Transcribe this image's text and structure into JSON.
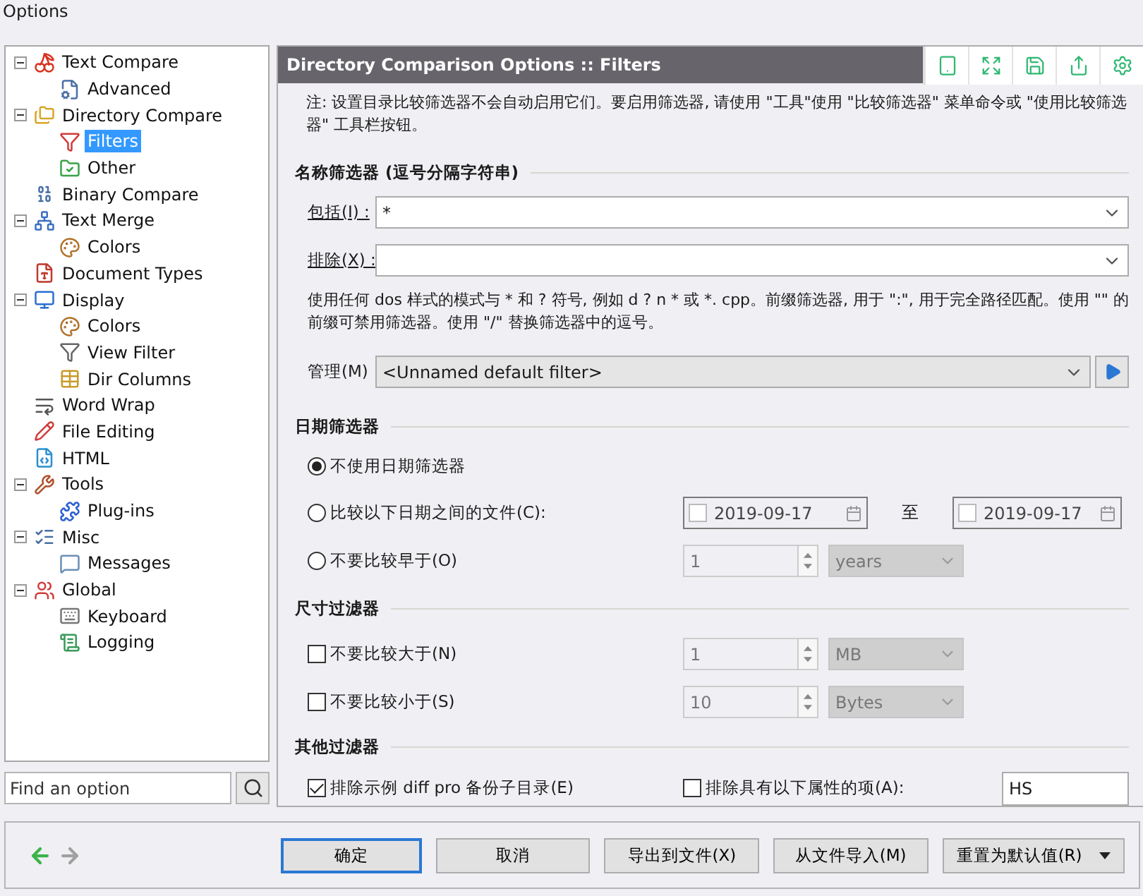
{
  "window": {
    "title": "Options"
  },
  "tree": [
    {
      "label": "Text Compare",
      "expanded": true,
      "selected": false,
      "children": [
        {
          "label": "Advanced",
          "selected": false
        }
      ]
    },
    {
      "label": "Directory Compare",
      "expanded": true,
      "selected": false,
      "children": [
        {
          "label": "Filters",
          "selected": true
        },
        {
          "label": "Other",
          "selected": false
        }
      ]
    },
    {
      "label": "Binary Compare",
      "selected": false
    },
    {
      "label": "Text Merge",
      "expanded": true,
      "selected": false,
      "children": [
        {
          "label": "Colors",
          "selected": false
        }
      ]
    },
    {
      "label": "Document Types",
      "selected": false
    },
    {
      "label": "Display",
      "expanded": true,
      "selected": false,
      "children": [
        {
          "label": "Colors",
          "selected": false
        },
        {
          "label": "View Filter",
          "selected": false
        },
        {
          "label": "Dir Columns",
          "selected": false
        }
      ]
    },
    {
      "label": "Word Wrap",
      "selected": false
    },
    {
      "label": "File Editing",
      "selected": false
    },
    {
      "label": "HTML",
      "selected": false
    },
    {
      "label": "Tools",
      "expanded": true,
      "selected": false,
      "children": [
        {
          "label": "Plug-ins",
          "selected": false
        }
      ]
    },
    {
      "label": "Misc",
      "expanded": true,
      "selected": false,
      "children": [
        {
          "label": "Messages",
          "selected": false
        }
      ]
    },
    {
      "label": "Global",
      "expanded": true,
      "selected": false,
      "children": [
        {
          "label": "Keyboard",
          "selected": false
        },
        {
          "label": "Logging",
          "selected": false
        }
      ]
    }
  ],
  "search": {
    "placeholder": "Find an option"
  },
  "panel": {
    "title": "Directory Comparison Options :: Filters"
  },
  "note": "注: 设置目录比较筛选器不会自动启用它们。要启用筛选器, 请使用 \"工具\"使用 \"比较筛选器\" 菜单命令或 \"使用比较筛选器\" 工具栏按钮。",
  "name_filter": {
    "heading": "名称筛选器 (逗号分隔字符串)",
    "include": {
      "label": "包括(I) :",
      "value": "*"
    },
    "exclude": {
      "label": "排除(X) :"
    },
    "hint": "使用任何 dos 样式的模式与 * 和 ? 符号, 例如 d ? n * 或 *. cpp。前缀筛选器, 用于 \":\", 用于完全路径匹配。使用 \"\" 的前缀可禁用筛选器。使用 \"/\" 替换筛选器中的逗号。",
    "manage": {
      "label": "管理(M)",
      "value": "<Unnamed default filter>"
    }
  },
  "date_filter": {
    "heading": "日期筛选器",
    "options": [
      {
        "label": "不使用日期筛选器",
        "selected": true
      },
      {
        "label": "比较以下日期之间的文件(C):",
        "selected": false
      },
      {
        "label": "不要比较早于(O)",
        "selected": false
      }
    ],
    "from": {
      "value": "2019-09-17",
      "checked": false
    },
    "to_label": "至",
    "to": {
      "value": "2019-09-17",
      "checked": false
    },
    "age": {
      "value": "1",
      "unit": "years",
      "disabled": true
    }
  },
  "size_filter": {
    "heading": "尺寸过滤器",
    "rows": [
      {
        "label": "不要比较大于(N)",
        "checked": false,
        "value": "1",
        "unit": "MB",
        "disabled": true
      },
      {
        "label": "不要比较小于(S)",
        "checked": false,
        "value": "10",
        "unit": "Bytes",
        "disabled": true
      }
    ]
  },
  "other_filter": {
    "heading": "其他过滤器",
    "backup": {
      "label": "排除示例 diff pro 备份子目录(E)",
      "checked": true
    },
    "attributes": {
      "label": "排除具有以下属性的项(A):",
      "checked": false,
      "value": "HS"
    }
  },
  "nav": {
    "back_disabled": false,
    "forward_disabled": true
  },
  "buttons": [
    {
      "label": "确定",
      "default": true
    },
    {
      "label": "取消",
      "default": false
    },
    {
      "label": "导出到文件(X)",
      "default": false
    },
    {
      "label": "从文件导入(M)",
      "default": false
    },
    {
      "label": "重置为默认值(R)",
      "default": false,
      "split": true
    }
  ]
}
